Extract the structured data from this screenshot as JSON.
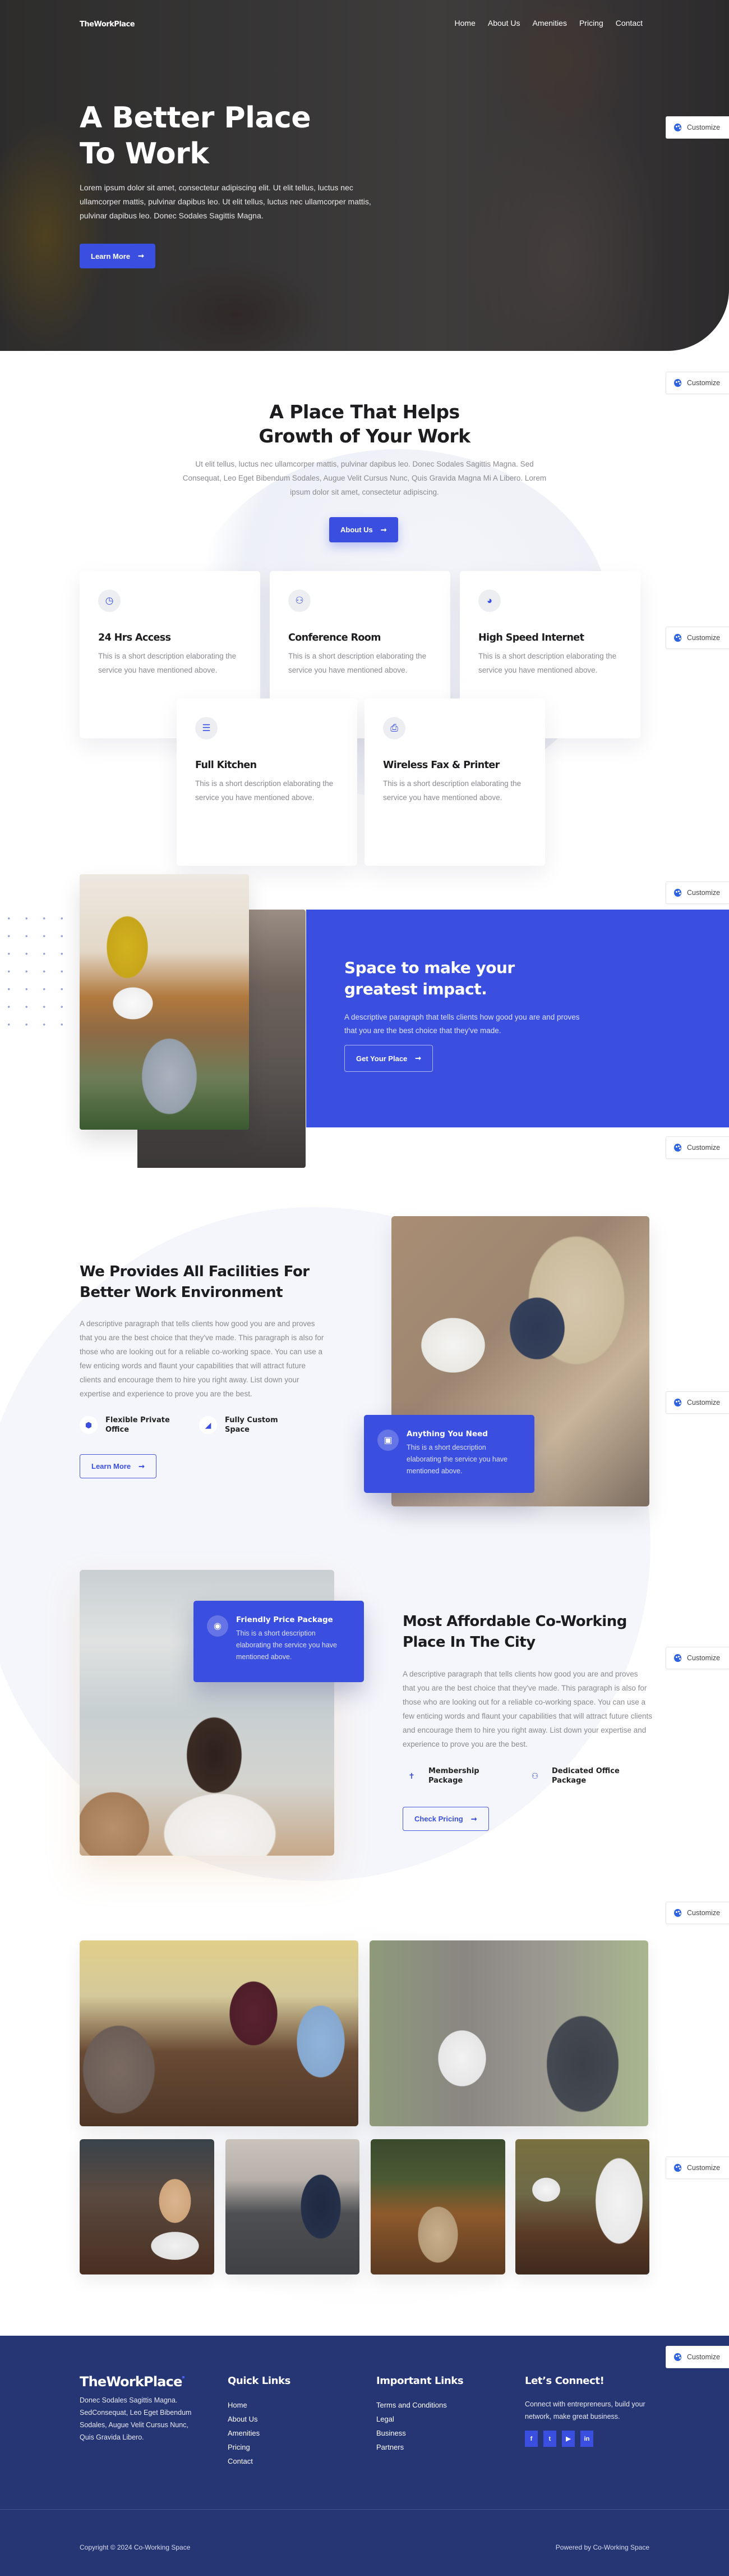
{
  "brand": "TheWorkPlace",
  "colors": {
    "accent": "#3a4ee0",
    "footer": "#263573"
  },
  "nav": {
    "items": [
      "Home",
      "About Us",
      "Amenities",
      "Pricing",
      "Contact"
    ]
  },
  "customize_label": "Customize",
  "hero": {
    "title_line1": "A Better Place",
    "title_line2": "To Work",
    "paragraph": "Lorem ipsum dolor sit amet, consectetur adipiscing elit. Ut elit tellus, luctus nec ullamcorper mattis, pulvinar dapibus leo. Ut elit tellus, luctus nec ullamcorper mattis, pulvinar dapibus leo. Donec Sodales Sagittis Magna.",
    "button": "Learn More"
  },
  "about": {
    "title_line1": "A Place That Helps",
    "title_line2": "Growth of Your Work",
    "paragraph": "Ut elit tellus, luctus nec ullamcorper mattis, pulvinar dapibus leo. Donec Sodales Sagittis Magna. Sed Consequat, Leo Eget Bibendum Sodales, Augue Velit Cursus Nunc, Quis Gravida Magna Mi A Libero. Lorem ipsum dolor sit amet, consectetur adipiscing.",
    "button": "About Us",
    "cards": [
      {
        "icon": "clock-icon",
        "title": "24 Hrs Access",
        "desc": "This is a short description elaborating the service you have mentioned above."
      },
      {
        "icon": "users-icon",
        "title": "Conference Room",
        "desc": "This is a short description elaborating the service you have mentioned above."
      },
      {
        "icon": "speedometer-icon",
        "title": "High Speed Internet",
        "desc": "This is a short description elaborating the service you have mentioned above."
      },
      {
        "icon": "burger-icon",
        "title": "Full Kitchen",
        "desc": "This is a short description elaborating the service you have mentioned above."
      },
      {
        "icon": "printer-icon",
        "title": "Wireless Fax & Printer",
        "desc": "This is a short description elaborating the service you have mentioned above."
      }
    ]
  },
  "space": {
    "title_line1": "Space to make your",
    "title_line2": "greatest impact.",
    "paragraph": "A descriptive paragraph that tells clients how good you are and proves that you are the best choice that they've made.",
    "button": "Get Your Place"
  },
  "facilities": {
    "title_line1": "We Provides All Facilities For",
    "title_line2": "Better Work Environment",
    "paragraph": "A descriptive paragraph that tells clients how good you are and proves that you are the best choice that they've made. This paragraph is also for those who are looking out for a reliable co-working space. You can use a few enticing words and flaunt your capabilities that will attract future clients and encourage them to hire you right away. List down your expertise and experience to prove you are the best.",
    "features": [
      {
        "icon": "cube-icon",
        "label": "Flexible Private Office"
      },
      {
        "icon": "swatchbook-icon",
        "label": "Fully Custom Space"
      }
    ],
    "button": "Learn More",
    "overlay": {
      "icon": "toolbox-icon",
      "title": "Anything You Need",
      "desc": "This is a short description elaborating the service you have mentioned above."
    }
  },
  "pricing": {
    "title_line1": "Most Affordable Co-Working",
    "title_line2": "Place In The City",
    "paragraph": "A descriptive paragraph that tells clients how good you are and proves that you are the best choice that they've made. This paragraph is also for those who are looking out for a reliable co-working space. You can use a few enticing words and flaunt your capabilities that will attract future clients and encourage them to hire you right away. List down your expertise and experience to prove you are the best.",
    "features": [
      {
        "icon": "person-icon",
        "label": "Membership Package"
      },
      {
        "icon": "users-icon",
        "label": "Dedicated Office Package"
      }
    ],
    "button": "Check Pricing",
    "overlay": {
      "icon": "piggy-bank-icon",
      "title": "Friendly Price Package",
      "desc": "This is a short description elaborating the service you have mentioned above."
    }
  },
  "footer": {
    "logo": "TheWorkPlace",
    "about": "Donec Sodales Sagittis Magna. SedConsequat, Leo Eget Bibendum Sodales, Augue Velit Cursus Nunc, Quis Gravida Libero.",
    "quick_title": "Quick Links",
    "quick_links": [
      "Home",
      "About Us",
      "Amenities",
      "Pricing",
      "Contact"
    ],
    "important_title": "Important Links",
    "important_links": [
      "Terms and Conditions",
      "Legal",
      "Business",
      "Partners"
    ],
    "connect_title": "Let’s Connect!",
    "connect_text": "Connect with entrepreneurs, build your network, make great business.",
    "social": [
      "facebook-icon",
      "twitter-icon",
      "youtube-icon",
      "linkedin-icon"
    ],
    "copyright": "Copyright © 2024 Co-Working Space",
    "powered": "Powered by Co-Working Space"
  }
}
